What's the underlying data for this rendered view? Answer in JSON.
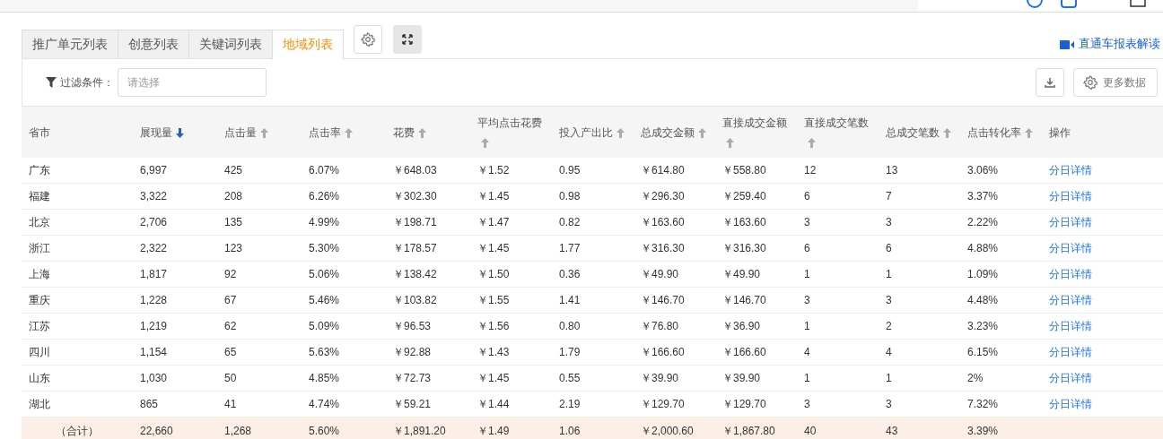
{
  "tabs": [
    {
      "label": "推广单元列表",
      "selected": false
    },
    {
      "label": "创意列表",
      "selected": false
    },
    {
      "label": "关键词列表",
      "selected": false
    },
    {
      "label": "地域列表",
      "selected": true
    }
  ],
  "tool_buttons": [
    {
      "kind": "settings"
    },
    {
      "kind": "fullscreen"
    }
  ],
  "video_link": "直通车报表解读",
  "filter": {
    "label": "过滤条件：",
    "placeholder": "请选择"
  },
  "more_data_button": "更多数据",
  "table": {
    "columns": [
      {
        "label": "省市"
      },
      {
        "label": "展现量",
        "sorted": true
      },
      {
        "label": "点击量",
        "sorted": false
      },
      {
        "label": "点击率",
        "sorted": false
      },
      {
        "label": "花费",
        "sorted": false
      },
      {
        "label": "平均点击花费",
        "sorted": false
      },
      {
        "label": "投入产出比",
        "sorted": false
      },
      {
        "label": "总成交金额",
        "sorted": false
      },
      {
        "label": "直接成交金额",
        "sorted": false
      },
      {
        "label": "直接成交笔数",
        "sorted": false
      },
      {
        "label": "总成交笔数",
        "sorted": false
      },
      {
        "label": "点击转化率",
        "sorted": false
      },
      {
        "label": "操作",
        "kind": "action"
      }
    ],
    "rows": [
      [
        "广东",
        "6,997",
        "425",
        "6.07%",
        "￥648.03",
        "￥1.52",
        "0.95",
        "￥614.80",
        "￥558.80",
        "12",
        "13",
        "3.06%",
        "分日详情"
      ],
      [
        "福建",
        "3,322",
        "208",
        "6.26%",
        "￥302.30",
        "￥1.45",
        "0.98",
        "￥296.30",
        "￥259.40",
        "6",
        "7",
        "3.37%",
        "分日详情"
      ],
      [
        "北京",
        "2,706",
        "135",
        "4.99%",
        "￥198.71",
        "￥1.47",
        "0.82",
        "￥163.60",
        "￥163.60",
        "3",
        "3",
        "2.22%",
        "分日详情"
      ],
      [
        "浙江",
        "2,322",
        "123",
        "5.30%",
        "￥178.57",
        "￥1.45",
        "1.77",
        "￥316.30",
        "￥316.30",
        "6",
        "6",
        "4.88%",
        "分日详情"
      ],
      [
        "上海",
        "1,817",
        "92",
        "5.06%",
        "￥138.42",
        "￥1.50",
        "0.36",
        "￥49.90",
        "￥49.90",
        "1",
        "1",
        "1.09%",
        "分日详情"
      ],
      [
        "重庆",
        "1,228",
        "67",
        "5.46%",
        "￥103.82",
        "￥1.55",
        "1.41",
        "￥146.70",
        "￥146.70",
        "3",
        "3",
        "4.48%",
        "分日详情"
      ],
      [
        "江苏",
        "1,219",
        "62",
        "5.09%",
        "￥96.53",
        "￥1.56",
        "0.80",
        "￥76.80",
        "￥36.90",
        "1",
        "2",
        "3.23%",
        "分日详情"
      ],
      [
        "四川",
        "1,154",
        "65",
        "5.63%",
        "￥92.88",
        "￥1.43",
        "1.79",
        "￥166.60",
        "￥166.60",
        "4",
        "4",
        "6.15%",
        "分日详情"
      ],
      [
        "山东",
        "1,030",
        "50",
        "4.85%",
        "￥72.73",
        "￥1.45",
        "0.55",
        "￥39.90",
        "￥39.90",
        "1",
        "1",
        "2%",
        "分日详情"
      ],
      [
        "湖北",
        "865",
        "41",
        "4.74%",
        "￥59.21",
        "￥1.44",
        "2.19",
        "￥129.70",
        "￥129.70",
        "3",
        "3",
        "7.32%",
        "分日详情"
      ]
    ],
    "total": [
      "（合计）",
      "22,660",
      "1,268",
      "5.60%",
      "￥1,891.20",
      "￥1.49",
      "1.06",
      "￥2,000.60",
      "￥1,867.80",
      "40",
      "43",
      "3.39%"
    ]
  }
}
